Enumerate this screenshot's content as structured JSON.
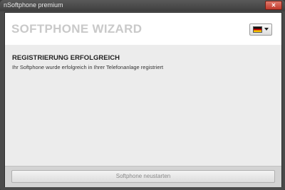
{
  "window": {
    "title": "nSoftphone premium",
    "close_glyph": "✕"
  },
  "header": {
    "title": "SOFTPHONE WIZARD",
    "language": {
      "selected": "Deutsch",
      "flag_icon": "germany-flag-icon",
      "dropdown_icon": "chevron-down-icon"
    }
  },
  "content": {
    "heading": "REGISTRIERUNG ERFOLGREICH",
    "message": "Ihr Softphone wurde erfolgreich in Ihrer Telefonanlage registriert"
  },
  "footer": {
    "button_label": "Softphone neustarten"
  }
}
